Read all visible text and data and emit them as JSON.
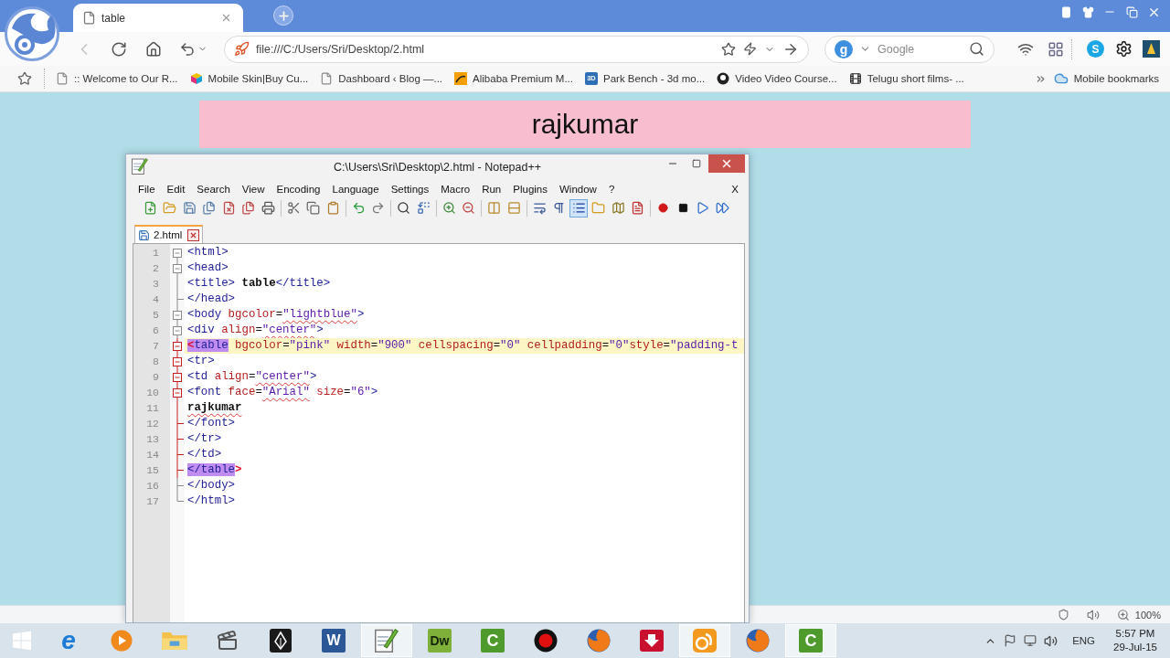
{
  "browser": {
    "tabs": [
      {
        "title": "table",
        "selected": true
      }
    ],
    "address": {
      "value": "file:///C:/Users/Sri/Desktop/2.html"
    },
    "search": {
      "engine": "g",
      "placeholder": "Google"
    },
    "chat_badge": "S",
    "bookmarks": [
      {
        "kind": "page",
        "label": ":: Welcome to Our R..."
      },
      {
        "kind": "cube",
        "label": "Mobile Skin|Buy Cu..."
      },
      {
        "kind": "page",
        "label": "Dashboard ‹ Blog —..."
      },
      {
        "kind": "tile",
        "label": "Alibaba Premium M..."
      },
      {
        "kind": "badge",
        "badge": "3D",
        "label": "Park Bench - 3d mo..."
      },
      {
        "kind": "disc",
        "label": "Video Video Course..."
      },
      {
        "kind": "film",
        "label": "Telugu short films- ..."
      }
    ],
    "mobile_bookmarks": "Mobile bookmarks",
    "zoom": "100%"
  },
  "page": {
    "banner": "rajkumar"
  },
  "editor_window": {
    "title": "C:\\Users\\Sri\\Desktop\\2.html - Notepad++",
    "menu": [
      "File",
      "Edit",
      "Search",
      "View",
      "Encoding",
      "Language",
      "Settings",
      "Macro",
      "Run",
      "Plugins",
      "Window",
      "?"
    ],
    "menu_close": "X",
    "toolbar": [
      {
        "buttons": [
          {
            "kind": "new",
            "on": false
          },
          {
            "kind": "open",
            "on": false
          },
          {
            "kind": "save",
            "on": false
          },
          {
            "kind": "save_all",
            "on": false
          },
          {
            "kind": "close",
            "on": false
          },
          {
            "kind": "close_all",
            "on": false
          },
          {
            "kind": "print",
            "on": false
          }
        ]
      },
      {
        "buttons": [
          {
            "kind": "cut",
            "on": false
          },
          {
            "kind": "copy",
            "on": false
          },
          {
            "kind": "paste",
            "on": false
          }
        ]
      },
      {
        "buttons": [
          {
            "kind": "undo",
            "on": false
          },
          {
            "kind": "redo",
            "on": false
          }
        ]
      },
      {
        "buttons": [
          {
            "kind": "find",
            "on": false
          },
          {
            "kind": "replace",
            "on": false
          }
        ]
      },
      {
        "buttons": [
          {
            "kind": "zoom_in",
            "on": false
          },
          {
            "kind": "zoom_out",
            "on": false
          }
        ]
      },
      {
        "buttons": [
          {
            "kind": "sync_v",
            "on": false
          },
          {
            "kind": "sync_h",
            "on": false
          }
        ]
      },
      {
        "buttons": [
          {
            "kind": "wrap",
            "on": false
          },
          {
            "kind": "all_chars",
            "on": false
          },
          {
            "kind": "indent_guide",
            "on": true
          },
          {
            "kind": "workspace",
            "on": false
          },
          {
            "kind": "doc_map",
            "on": false
          },
          {
            "kind": "func_list",
            "on": false
          }
        ]
      },
      {
        "buttons": [
          {
            "kind": "record",
            "on": false
          },
          {
            "kind": "stop",
            "on": false
          },
          {
            "kind": "play",
            "on": false
          },
          {
            "kind": "play_multi",
            "on": false
          }
        ]
      }
    ],
    "tabs": [
      {
        "label": "2.html",
        "selected": true
      }
    ],
    "lines": [
      {
        "number": "1",
        "kind": "open",
        "current": false,
        "in_block": false,
        "tokens": [
          {
            "kind": "tag",
            "text": "<html>",
            "match": false,
            "spell": false
          }
        ]
      },
      {
        "number": "2",
        "kind": "open",
        "current": false,
        "in_block": false,
        "tokens": [
          {
            "kind": "tag",
            "text": "<head>",
            "match": false,
            "spell": false
          }
        ]
      },
      {
        "number": "3",
        "kind": "body",
        "current": false,
        "in_block": false,
        "tokens": [
          {
            "kind": "tag",
            "text": "<title>",
            "match": false,
            "spell": false
          },
          {
            "kind": "text",
            "text": " table",
            "match": false,
            "spell": false
          },
          {
            "kind": "tag",
            "text": "</title>",
            "match": false,
            "spell": false
          }
        ]
      },
      {
        "number": "4",
        "kind": "end",
        "current": false,
        "in_block": false,
        "tokens": [
          {
            "kind": "tag",
            "text": "</head>",
            "match": false,
            "spell": false
          }
        ]
      },
      {
        "number": "5",
        "kind": "open",
        "current": false,
        "in_block": false,
        "tokens": [
          {
            "kind": "tag",
            "text": "<body",
            "match": false,
            "spell": false
          },
          {
            "kind": "attr",
            "text": " bgcolor",
            "match": false,
            "spell": false
          },
          {
            "kind": "eq",
            "text": "=",
            "match": false,
            "spell": false
          },
          {
            "kind": "value",
            "text": "\"lightblue\"",
            "match": false,
            "spell": true
          },
          {
            "kind": "tag",
            "text": ">",
            "match": false,
            "spell": false
          }
        ]
      },
      {
        "number": "6",
        "kind": "open",
        "current": false,
        "in_block": false,
        "tokens": [
          {
            "kind": "tag",
            "text": "<div",
            "match": false,
            "spell": false
          },
          {
            "kind": "attr",
            "text": " align",
            "match": false,
            "spell": false
          },
          {
            "kind": "eq",
            "text": "=",
            "match": false,
            "spell": false
          },
          {
            "kind": "value",
            "text": "\"center\"",
            "match": false,
            "spell": true
          },
          {
            "kind": "tag",
            "text": ">",
            "match": false,
            "spell": false
          }
        ]
      },
      {
        "number": "7",
        "kind": "open",
        "current": true,
        "in_block": true,
        "tokens": [
          {
            "kind": "brace",
            "text": "<",
            "match": true,
            "spell": false
          },
          {
            "kind": "tag",
            "text": "table",
            "match": true,
            "spell": false
          },
          {
            "kind": "attr",
            "text": " bgcolor",
            "match": false,
            "spell": false
          },
          {
            "kind": "eq",
            "text": "=",
            "match": false,
            "spell": false
          },
          {
            "kind": "value",
            "text": "\"pink\"",
            "match": false,
            "spell": false
          },
          {
            "kind": "attr",
            "text": " width",
            "match": false,
            "spell": false
          },
          {
            "kind": "eq",
            "text": "=",
            "match": false,
            "spell": false
          },
          {
            "kind": "value",
            "text": "\"900\"",
            "match": false,
            "spell": false
          },
          {
            "kind": "attr",
            "text": " cellspacing",
            "match": false,
            "spell": false
          },
          {
            "kind": "eq",
            "text": "=",
            "match": false,
            "spell": false
          },
          {
            "kind": "value",
            "text": "\"0\"",
            "match": false,
            "spell": false
          },
          {
            "kind": "attr",
            "text": " cellpadding",
            "match": false,
            "spell": false
          },
          {
            "kind": "eq",
            "text": "=",
            "match": false,
            "spell": false
          },
          {
            "kind": "value",
            "text": "\"0\"",
            "match": false,
            "spell": false
          },
          {
            "kind": "attr",
            "text": "style",
            "match": false,
            "spell": false
          },
          {
            "kind": "eq",
            "text": "=",
            "match": false,
            "spell": false
          },
          {
            "kind": "value",
            "text": "\"padding-t",
            "match": false,
            "spell": false
          }
        ]
      },
      {
        "number": "8",
        "kind": "open",
        "current": false,
        "in_block": true,
        "tokens": [
          {
            "kind": "tag",
            "text": "<tr>",
            "match": false,
            "spell": false
          }
        ]
      },
      {
        "number": "9",
        "kind": "open",
        "current": false,
        "in_block": true,
        "tokens": [
          {
            "kind": "tag",
            "text": "<td",
            "match": false,
            "spell": false
          },
          {
            "kind": "attr",
            "text": " align",
            "match": false,
            "spell": false
          },
          {
            "kind": "eq",
            "text": "=",
            "match": false,
            "spell": false
          },
          {
            "kind": "value",
            "text": "\"center\"",
            "match": false,
            "spell": true
          },
          {
            "kind": "tag",
            "text": ">",
            "match": false,
            "spell": false
          }
        ]
      },
      {
        "number": "10",
        "kind": "open",
        "current": false,
        "in_block": true,
        "tokens": [
          {
            "kind": "tag",
            "text": "<font",
            "match": false,
            "spell": false
          },
          {
            "kind": "attr",
            "text": " face",
            "match": false,
            "spell": false
          },
          {
            "kind": "eq",
            "text": "=",
            "match": false,
            "spell": false
          },
          {
            "kind": "value",
            "text": "\"Arial\"",
            "match": false,
            "spell": true
          },
          {
            "kind": "attr",
            "text": " size",
            "match": false,
            "spell": false
          },
          {
            "kind": "eq",
            "text": "=",
            "match": false,
            "spell": false
          },
          {
            "kind": "value",
            "text": "\"6\"",
            "match": false,
            "spell": false
          },
          {
            "kind": "tag",
            "text": ">",
            "match": false,
            "spell": false
          }
        ]
      },
      {
        "number": "11",
        "kind": "body",
        "current": false,
        "in_block": true,
        "tokens": [
          {
            "kind": "text",
            "text": "rajkumar",
            "match": false,
            "spell": true
          }
        ]
      },
      {
        "number": "12",
        "kind": "end",
        "current": false,
        "in_block": true,
        "tokens": [
          {
            "kind": "tag",
            "text": "</font>",
            "match": false,
            "spell": false
          }
        ]
      },
      {
        "number": "13",
        "kind": "end",
        "current": false,
        "in_block": true,
        "tokens": [
          {
            "kind": "tag",
            "text": "</tr>",
            "match": false,
            "spell": false
          }
        ]
      },
      {
        "number": "14",
        "kind": "end",
        "current": false,
        "in_block": true,
        "tokens": [
          {
            "kind": "tag",
            "text": "</td>",
            "match": false,
            "spell": false
          }
        ]
      },
      {
        "number": "15",
        "kind": "end",
        "current": false,
        "in_block": true,
        "tokens": [
          {
            "kind": "tag",
            "text": "</table",
            "match": true,
            "spell": false
          },
          {
            "kind": "brace",
            "text": ">",
            "match": false,
            "spell": false
          }
        ]
      },
      {
        "number": "16",
        "kind": "end",
        "current": false,
        "in_block": false,
        "tokens": [
          {
            "kind": "tag",
            "text": "</body>",
            "match": false,
            "spell": false
          }
        ]
      },
      {
        "number": "17",
        "kind": "last",
        "current": false,
        "in_block": false,
        "tokens": [
          {
            "kind": "tag",
            "text": "</html>",
            "match": false,
            "spell": false
          }
        ]
      }
    ]
  },
  "taskbar": {
    "apps": [
      {
        "kind": "ie",
        "glyph": "e",
        "active": false
      },
      {
        "kind": "media",
        "active": false
      },
      {
        "kind": "explorer",
        "active": false
      },
      {
        "kind": "clapper",
        "active": false
      },
      {
        "kind": "pen",
        "active": false
      },
      {
        "kind": "word",
        "glyph": "W",
        "active": false
      },
      {
        "kind": "notepad",
        "active": true
      },
      {
        "kind": "dreamweaver",
        "glyph": "Dw",
        "active": false
      },
      {
        "kind": "camtasia",
        "glyph": "C",
        "active": false
      },
      {
        "kind": "record",
        "active": false
      },
      {
        "kind": "firefox",
        "active": false
      },
      {
        "kind": "download",
        "active": false
      },
      {
        "kind": "uc",
        "active": true
      },
      {
        "kind": "firefox",
        "active": false
      },
      {
        "kind": "camtasia",
        "glyph": "C",
        "active": true
      }
    ],
    "language": "ENG",
    "time": "5:57 PM",
    "date": "29-Jul-15"
  }
}
